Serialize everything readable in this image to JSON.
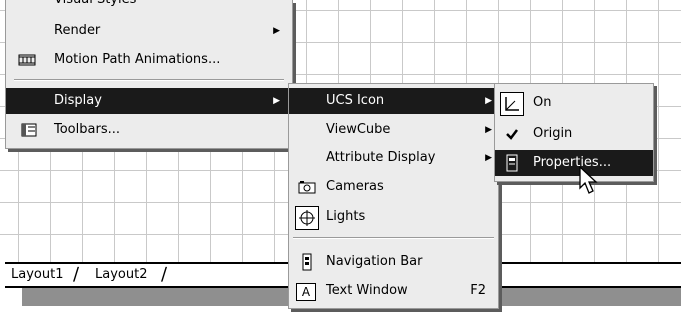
{
  "bg": {
    "grid_color": "#c9c9c9"
  },
  "tabs": [
    "Layout1",
    "Layout2"
  ],
  "menu_view": {
    "items": [
      {
        "label": "Visual Styles",
        "partial": true
      },
      {
        "label": "Render",
        "submenu": true
      },
      {
        "label": "Motion Path Animations...",
        "icon": "film-strip-icon"
      },
      {
        "label": "Display",
        "submenu": true,
        "selected": true
      },
      {
        "label": "Toolbars...",
        "icon": "toolbars-icon"
      }
    ]
  },
  "menu_display": {
    "items": [
      {
        "label": "UCS Icon",
        "submenu": true,
        "selected": true
      },
      {
        "label": "ViewCube",
        "submenu": true
      },
      {
        "label": "Attribute Display",
        "submenu": true
      },
      {
        "label": "Cameras",
        "icon": "camera-icon"
      },
      {
        "label": "Lights",
        "icon": "lights-icon"
      },
      {
        "label": "Navigation Bar",
        "icon": "navigation-bar-icon"
      },
      {
        "label": "Text Window",
        "icon": "text-window-icon",
        "shortcut": "F2"
      }
    ]
  },
  "menu_ucs": {
    "items": [
      {
        "label": "On",
        "icon": "ucs-axes-icon"
      },
      {
        "label": "Origin",
        "checked": true
      },
      {
        "label": "Properties...",
        "selected": true,
        "icon": "properties-icon"
      }
    ]
  },
  "colors": {
    "menu_bg": "#ececec",
    "selected_bg": "#1a1a1a",
    "selected_fg": "#ffffff"
  }
}
